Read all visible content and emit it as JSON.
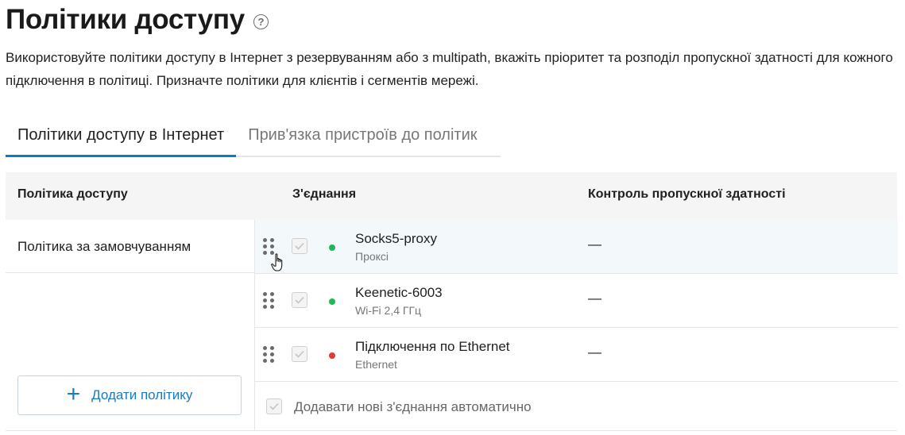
{
  "page": {
    "title": "Політики доступу",
    "help_icon": "question-circle-icon",
    "description": "Використовуйте політики доступу в Інтернет з резервуванням або з multipath, вкажіть пріоритет та розподіл пропускної здатності для кожного підключення в політиці. Призначте політики для клієнтів і сегментів мережі."
  },
  "tabs": [
    {
      "label": "Політики доступу в Інтернет",
      "active": true
    },
    {
      "label": "Прив'язка пристроїв до політик",
      "active": false
    }
  ],
  "table": {
    "headers": {
      "policy": "Політика доступу",
      "connection": "З'єднання",
      "bandwidth": "Контроль пропускної здатності"
    },
    "policies": [
      {
        "name": "Політика за замовчуванням"
      }
    ],
    "add_policy_label": "Додати політику",
    "connections": [
      {
        "name": "Socks5-proxy",
        "type": "Проксі",
        "status_color": "#1db954",
        "bandwidth": "—",
        "checked": true
      },
      {
        "name": "Keenetic-6003",
        "type": "Wi-Fi 2,4 ГГц",
        "status_color": "#1db954",
        "bandwidth": "—",
        "checked": true
      },
      {
        "name": "Підключення по Ethernet",
        "type": "Ethernet",
        "status_color": "#e53935",
        "bandwidth": "—",
        "checked": true
      }
    ],
    "auto_add_label": "Додавати нові з'єднання автоматично"
  },
  "colors": {
    "accent": "#0f7ac0",
    "status_up": "#1db954",
    "status_down": "#e53935"
  }
}
